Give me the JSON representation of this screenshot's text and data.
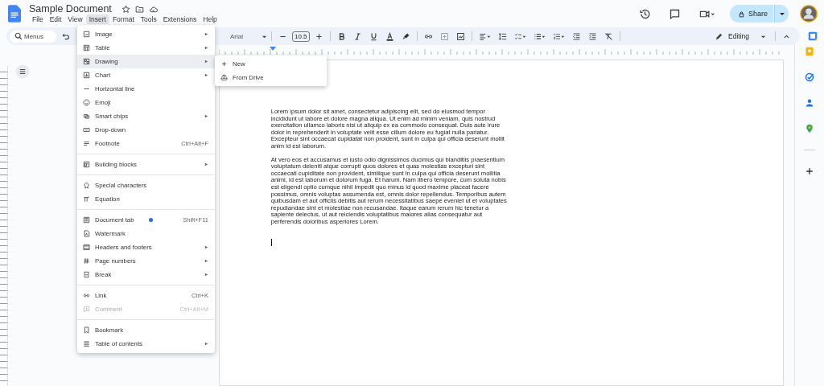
{
  "document": {
    "title": "Sample Document",
    "starred": false,
    "paragraphs": [
      "Lorem ipsum dolor sit amet, consectetur adipiscing elit, sed do eiusmod tempor incididunt ut labore et dolore magna aliqua. Ut enim ad minim veniam, quis nostrud exercitation ullamco laboris nisi ut aliquip ex ea commodo consequat. Duis aute irure dolor in reprehenderit in voluptate velit esse cillum dolore eu fugiat nulla pariatur. Excepteur sint occaecat cupidatat non proident, sunt in culpa qui officia deserunt mollit anim id est laborum.",
      "At vero eos et accusamus et iusto odio dignissimos ducimus qui blanditiis praesentium voluptatum deleniti atque corrupti quos dolores et quas molestias excepturi sint occaecati cupiditate non provident, similique sunt in culpa qui officia deserunt mollitia animi, id est laborum et dolorum fuga. Et harum. Nam libero tempore, cum soluta nobis est eligendi optio cumque nihil impedit quo minus id quod maxime placeat facere possimus, omnis voluptas assumenda est, omnis dolor repellendus. Temporibus autem quibusdam et aut officiis debitis aut rerum necessitatibus saepe eveniet ut et voluptates repudiandae sint et molestiae non recusandae. Itaque earum rerum hic tenetur a sapiente delectus, ut aut reiciendis voluptatibus maiores alias consequatur aut perferendis doloribus asperiores Lorem."
    ]
  },
  "menubar": [
    {
      "label": "File",
      "selected": false
    },
    {
      "label": "Edit",
      "selected": false
    },
    {
      "label": "View",
      "selected": false
    },
    {
      "label": "Insert",
      "selected": true
    },
    {
      "label": "Format",
      "selected": false
    },
    {
      "label": "Tools",
      "selected": false
    },
    {
      "label": "Extensions",
      "selected": false
    },
    {
      "label": "Help",
      "selected": false
    }
  ],
  "header": {
    "share": "Share"
  },
  "toolbar": {
    "search_placeholder": "Menus",
    "font": "Arial",
    "font_size": "10.5",
    "mode": "Editing"
  },
  "insert_menu": {
    "sections": [
      [
        {
          "label": "Image",
          "submenu": true,
          "selected": false,
          "disabled": false
        },
        {
          "label": "Table",
          "submenu": true,
          "selected": false,
          "disabled": false
        },
        {
          "label": "Drawing",
          "submenu": true,
          "selected": true,
          "disabled": false
        },
        {
          "label": "Chart",
          "submenu": true,
          "selected": false,
          "disabled": false
        },
        {
          "label": "Horizontal line",
          "submenu": false,
          "selected": false,
          "disabled": false
        },
        {
          "label": "Emoji",
          "submenu": false,
          "selected": false,
          "disabled": false
        },
        {
          "label": "Smart chips",
          "submenu": true,
          "selected": false,
          "disabled": false
        },
        {
          "label": "Drop-down",
          "submenu": false,
          "selected": false,
          "disabled": false
        },
        {
          "label": "Footnote",
          "shortcut": "Ctrl+Alt+F",
          "submenu": false,
          "selected": false,
          "disabled": false
        }
      ],
      [
        {
          "label": "Building blocks",
          "submenu": true,
          "selected": false,
          "disabled": false
        }
      ],
      [
        {
          "label": "Special characters",
          "submenu": false,
          "selected": false,
          "disabled": false
        },
        {
          "label": "Equation",
          "submenu": false,
          "selected": false,
          "disabled": false
        }
      ],
      [
        {
          "label": "Document tab",
          "shortcut": "Shift+F11",
          "new_dot": true,
          "submenu": false,
          "selected": false,
          "disabled": false
        },
        {
          "label": "Watermark",
          "submenu": false,
          "selected": false,
          "disabled": false
        },
        {
          "label": "Headers and footers",
          "submenu": true,
          "selected": false,
          "disabled": false
        },
        {
          "label": "Page numbers",
          "submenu": true,
          "selected": false,
          "disabled": false
        },
        {
          "label": "Break",
          "submenu": true,
          "selected": false,
          "disabled": false
        }
      ],
      [
        {
          "label": "Link",
          "shortcut": "Ctrl+K",
          "submenu": false,
          "selected": false,
          "disabled": false
        },
        {
          "label": "Comment",
          "shortcut": "Ctrl+Alt+M",
          "submenu": false,
          "selected": false,
          "disabled": true
        }
      ],
      [
        {
          "label": "Bookmark",
          "submenu": false,
          "selected": false,
          "disabled": false
        },
        {
          "label": "Table of contents",
          "submenu": true,
          "selected": false,
          "disabled": false
        }
      ]
    ]
  },
  "drawing_submenu": [
    {
      "label": "New"
    },
    {
      "label": "From Drive"
    }
  ]
}
